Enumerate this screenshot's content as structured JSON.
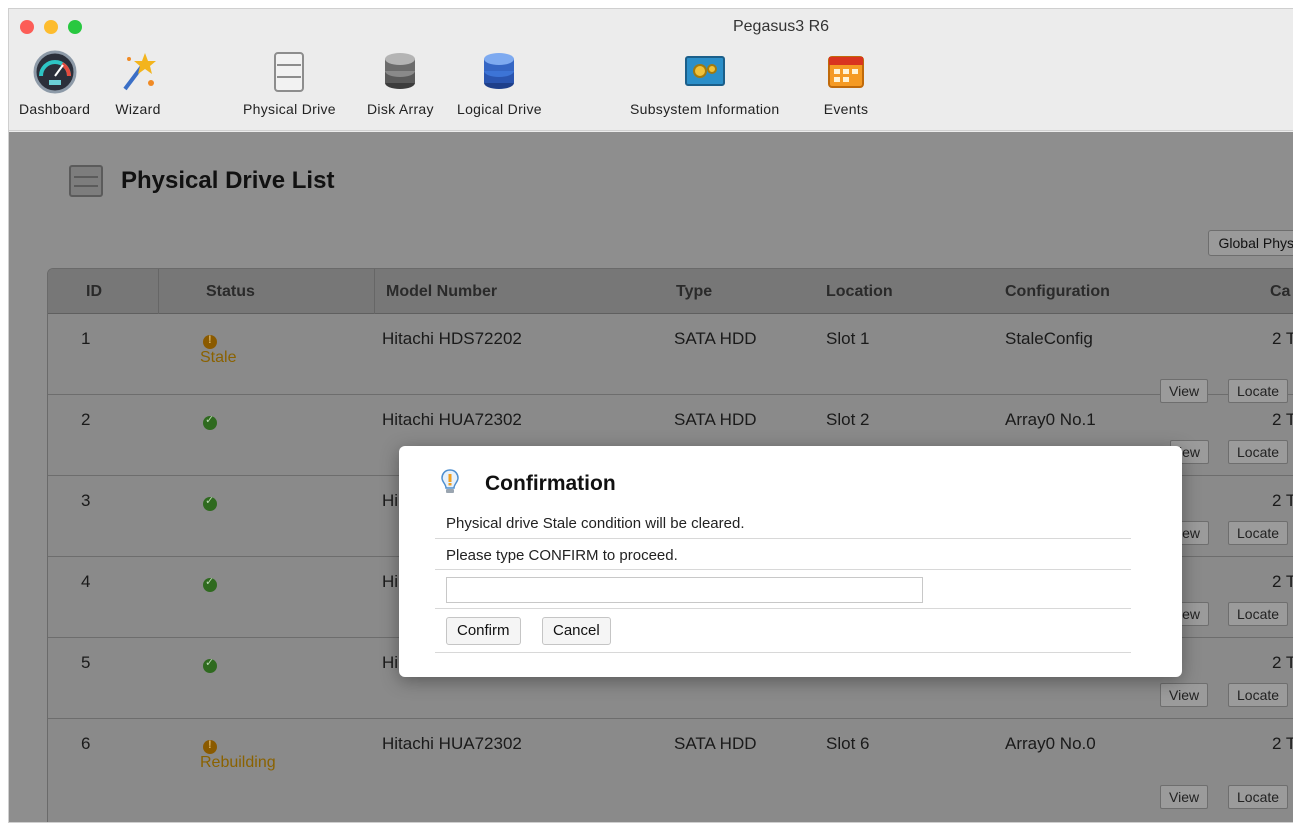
{
  "window": {
    "title": "Pegasus3 R6"
  },
  "toolbar": {
    "items": [
      {
        "label": "Dashboard",
        "icon": "gauge-icon"
      },
      {
        "label": "Wizard",
        "icon": "wizard-wand-icon"
      },
      {
        "label": "Physical Drive",
        "icon": "physical-drive-icon"
      },
      {
        "label": "Disk Array",
        "icon": "disk-array-icon"
      },
      {
        "label": "Logical Drive",
        "icon": "logical-drive-icon"
      },
      {
        "label": "Subsystem Information",
        "icon": "subsystem-info-icon"
      },
      {
        "label": "Events",
        "icon": "calendar-events-icon"
      }
    ]
  },
  "page": {
    "title": "Physical Drive List",
    "global_button": "Global Phys"
  },
  "table": {
    "columns": [
      "ID",
      "Status",
      "Model Number",
      "Type",
      "Location",
      "Configuration",
      "Ca"
    ],
    "rows": [
      {
        "id": "1",
        "status": "stale",
        "status_text": "Stale",
        "model": "Hitachi HDS72202",
        "type": "SATA HDD",
        "location": "Slot 1",
        "config": "StaleConfig",
        "cap": "2 T",
        "view": "View",
        "locate": "Locate"
      },
      {
        "id": "2",
        "status": "ok",
        "status_text": "",
        "model": "Hitachi HUA72302",
        "type": "SATA HDD",
        "location": "Slot 2",
        "config": "Array0 No.1",
        "cap": "2 T",
        "view": "iew",
        "locate": "Locate"
      },
      {
        "id": "3",
        "status": "ok",
        "status_text": "",
        "model": "Hi",
        "type": "",
        "location": "",
        "config": "",
        "cap": "2 T",
        "view": "iew",
        "locate": "Locate"
      },
      {
        "id": "4",
        "status": "ok",
        "status_text": "",
        "model": "Hi",
        "type": "",
        "location": "",
        "config": "",
        "cap": "2 T",
        "view": "iew",
        "locate": "Locate"
      },
      {
        "id": "5",
        "status": "ok",
        "status_text": "",
        "model": "Hi",
        "type": "",
        "location": "",
        "config": "",
        "cap": "2 T",
        "view": "View",
        "locate": "Locate"
      },
      {
        "id": "6",
        "status": "rebuilding",
        "status_text": "Rebuilding",
        "model": "Hitachi HUA72302",
        "type": "SATA HDD",
        "location": "Slot 6",
        "config": "Array0 No.0",
        "cap": "2 T",
        "view": "View",
        "locate": "Locate"
      }
    ]
  },
  "dialog": {
    "title": "Confirmation",
    "message": "Physical drive Stale condition will be cleared.",
    "prompt": "Please type CONFIRM to proceed.",
    "input_value": "",
    "confirm_label": "Confirm",
    "cancel_label": "Cancel"
  },
  "colors": {
    "warning": "#8a6200",
    "ok": "#2f6a1f",
    "dim_background": "#8e8e8e"
  }
}
